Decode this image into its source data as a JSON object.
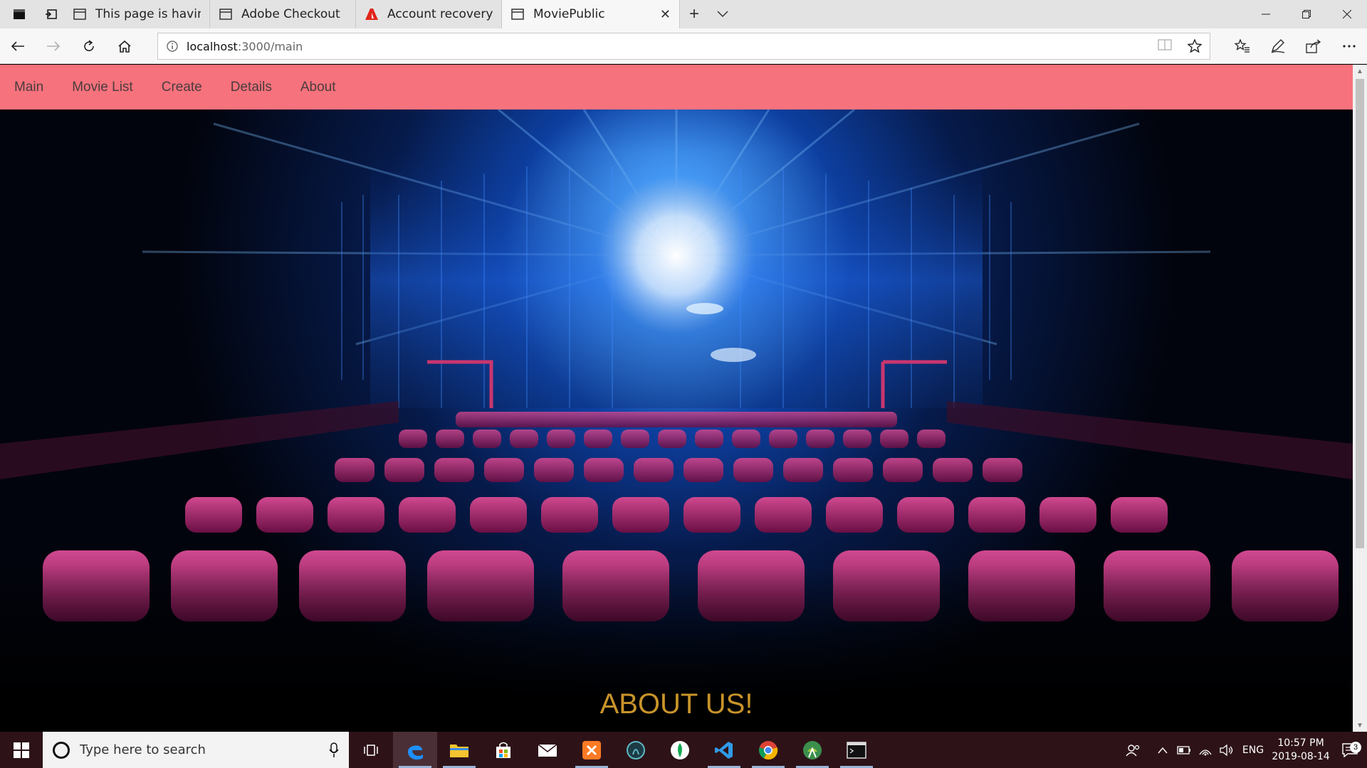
{
  "browser": {
    "tabs": [
      {
        "title": "This page is having a proble",
        "icon": "page-icon"
      },
      {
        "title": "Adobe Checkout",
        "icon": "page-icon"
      },
      {
        "title": "Account recovery - Adobe I",
        "icon": "adobe-icon"
      },
      {
        "title": "MoviePublic",
        "icon": "page-icon",
        "active": true
      }
    ],
    "address": {
      "host": "localhost",
      "path": ":3000/main"
    }
  },
  "site": {
    "nav": [
      "Main",
      "Movie List",
      "Create",
      "Details",
      "About"
    ],
    "hero_heading": "ABOUT US!",
    "colors": {
      "nav_bg": "#f6727c",
      "heading": "#c8942a"
    }
  },
  "taskbar": {
    "search_placeholder": "Type here to search",
    "tray": {
      "language": "ENG",
      "time": "10:57 PM",
      "date": "2019-08-14",
      "notifications": "3"
    }
  }
}
